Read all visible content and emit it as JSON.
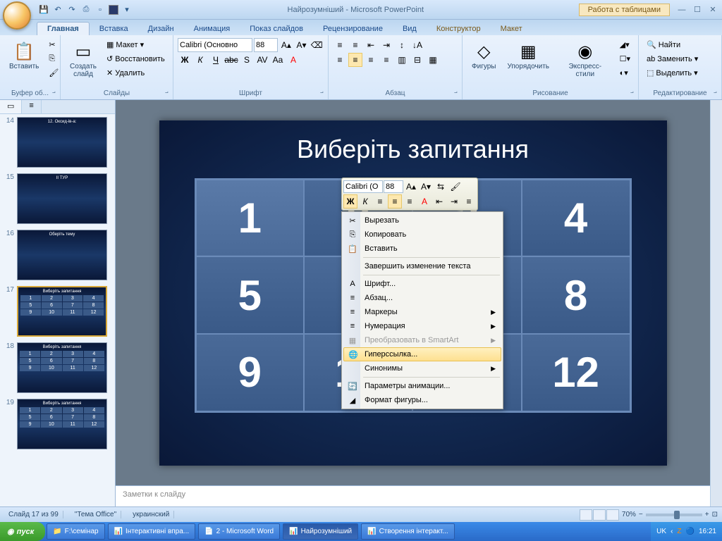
{
  "title": "Найрозумніший - Microsoft PowerPoint",
  "table_tools": "Работа с таблицами",
  "tabs": [
    "Главная",
    "Вставка",
    "Дизайн",
    "Анимация",
    "Показ слайдов",
    "Рецензирование",
    "Вид",
    "Конструктор",
    "Макет"
  ],
  "ribbon": {
    "clipboard": {
      "label": "Буфер об...",
      "paste": "Вставить"
    },
    "slides": {
      "label": "Слайды",
      "new": "Создать\nслайд",
      "layout": "Макет",
      "reset": "Восстановить",
      "delete": "Удалить"
    },
    "font": {
      "label": "Шрифт",
      "name": "Calibri (Основно",
      "size": "88"
    },
    "paragraph": {
      "label": "Абзац"
    },
    "drawing": {
      "label": "Рисование",
      "shapes": "Фигуры",
      "arrange": "Упорядочить",
      "styles": "Экспресс-стили"
    },
    "editing": {
      "label": "Редактирование",
      "find": "Найти",
      "replace": "Заменить",
      "select": "Выделить"
    }
  },
  "slide": {
    "title": "Виберіть запитання",
    "cells": [
      "1",
      "2",
      "3",
      "4",
      "5",
      "6",
      "7",
      "8",
      "9",
      "10",
      "11",
      "12"
    ]
  },
  "mini_font": {
    "name": "Calibri (О",
    "size": "88"
  },
  "context_menu": {
    "cut": "Вырезать",
    "copy": "Копировать",
    "paste": "Вставить",
    "endedit": "Завершить изменение текста",
    "font": "Шрифт...",
    "paragraph": "Абзац...",
    "bullets": "Маркеры",
    "numbering": "Нумерация",
    "smartart": "Преобразовать в SmartArt",
    "hyperlink": "Гиперссылка...",
    "synonyms": "Синонимы",
    "animation": "Параметры анимации...",
    "format": "Формат фигуры..."
  },
  "thumbs": [
    {
      "n": "14",
      "title": "12. Оксид-ів-а:"
    },
    {
      "n": "15",
      "title": "II ТУР"
    },
    {
      "n": "16",
      "title": "Оберіть тему"
    },
    {
      "n": "17",
      "title": "Виберіть запитання",
      "grid": true,
      "sel": true
    },
    {
      "n": "18",
      "title": "Виберіть запитання",
      "grid": true
    },
    {
      "n": "19",
      "title": "Виберіть запитання",
      "grid": true
    }
  ],
  "notes": "Заметки к слайду",
  "status": {
    "slide": "Слайд 17 из 99",
    "theme": "\"Тема Office\"",
    "lang": "украинский",
    "zoom": "70%"
  },
  "taskbar": {
    "start": "пуск",
    "items": [
      "F:\\семінар",
      "Інтерактивні впра...",
      "2 - Microsoft Word",
      "Найрозумніший",
      "Створення інтеракт..."
    ],
    "lang": "UK",
    "time": "16:21"
  }
}
